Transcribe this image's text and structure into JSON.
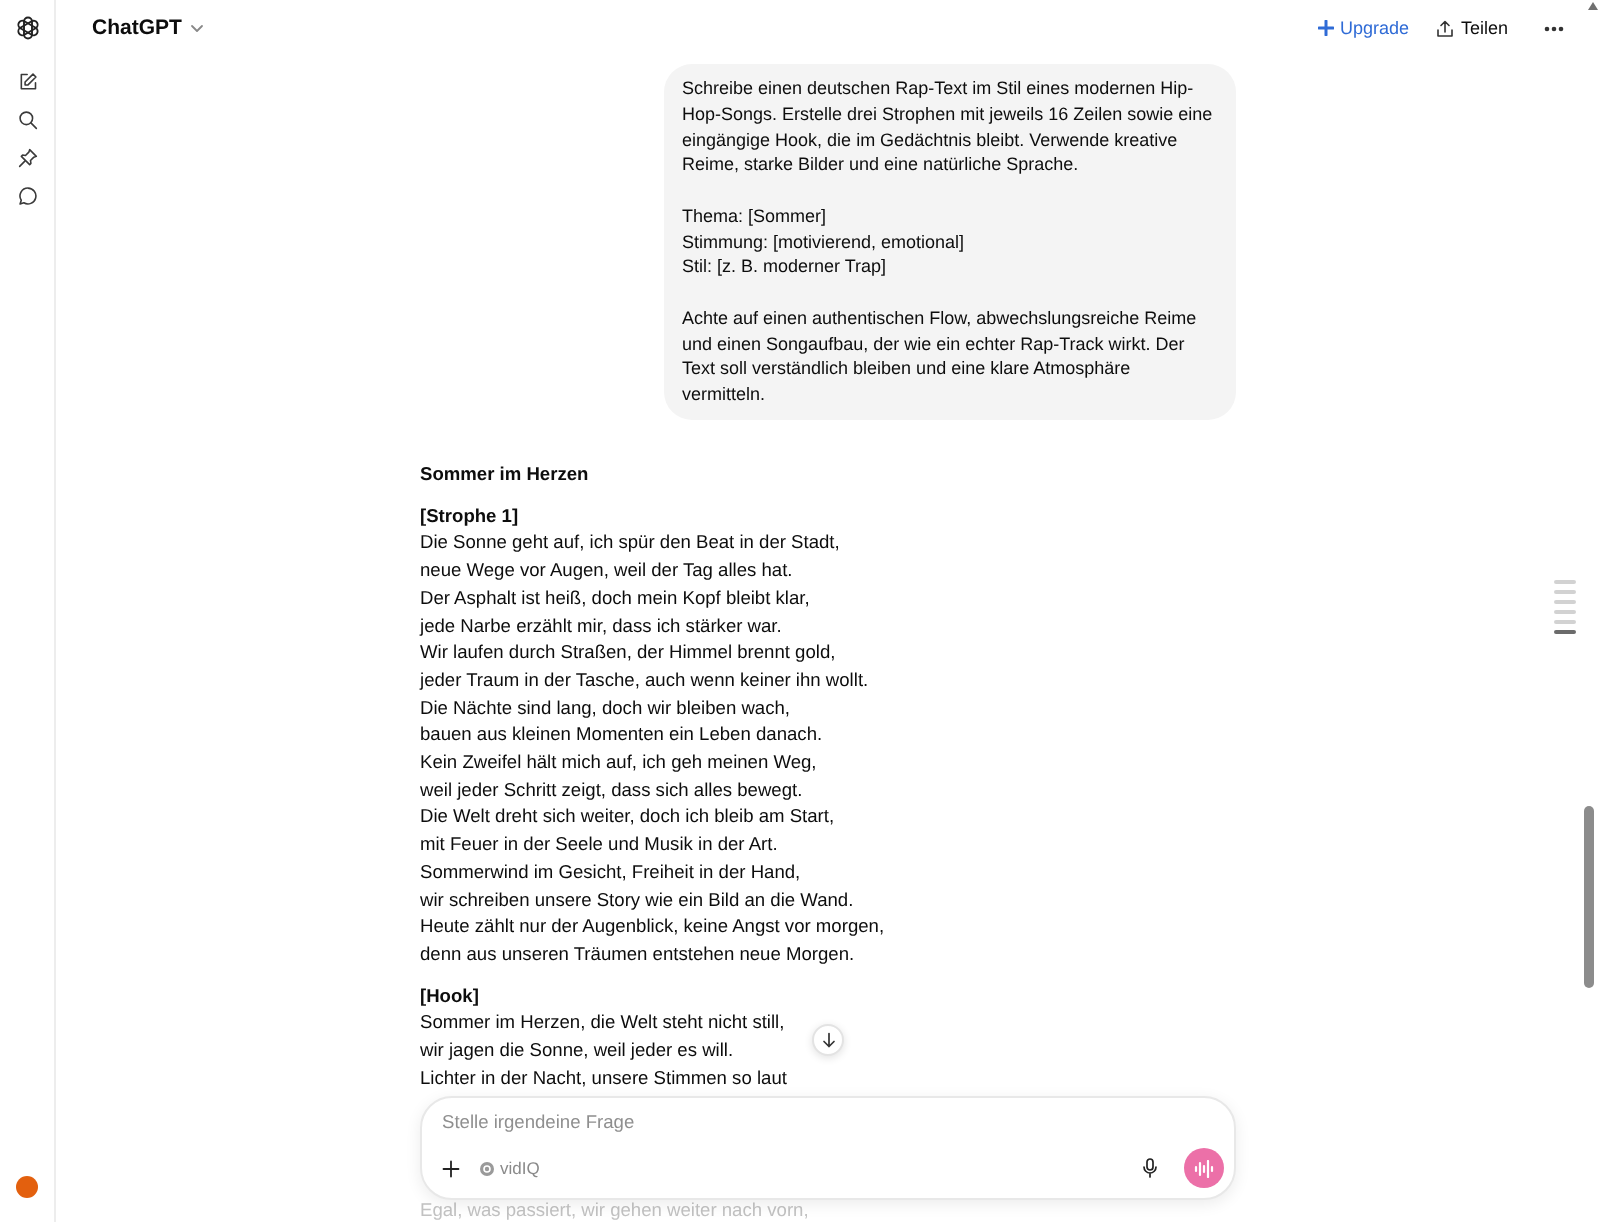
{
  "header": {
    "title": "ChatGPT",
    "upgrade": "Upgrade",
    "share": "Teilen"
  },
  "user_message": {
    "paragraphs": [
      [
        "Schreibe einen deutschen Rap-Text im Stil eines modernen Hip-Hop-Songs. Erstelle drei Strophen mit jeweils 16 Zeilen sowie eine eingängige Hook, die im Gedächtnis bleibt. Verwende kreative Reime, starke Bilder und eine natürliche Sprache."
      ],
      [
        "Thema: [Sommer]",
        "Stimmung: [motivierend, emotional]",
        "Stil: [z. B. moderner Trap]"
      ],
      [
        "Achte auf einen authentischen Flow, abwechslungsreiche Reime und einen Songaufbau, der wie ein echter Rap-Track wirkt. Der Text soll verständlich bleiben und eine klare Atmosphäre vermitteln."
      ]
    ]
  },
  "response": {
    "title": "Sommer im Herzen",
    "sections": [
      {
        "heading": "[Strophe 1]",
        "lines": [
          "Die Sonne geht auf, ich spür den Beat in der Stadt,",
          "neue Wege vor Augen, weil der Tag alles hat.",
          "Der Asphalt ist heiß, doch mein Kopf bleibt klar,",
          "jede Narbe erzählt mir, dass ich stärker war.",
          "Wir laufen durch Straßen, der Himmel brennt gold,",
          "jeder Traum in der Tasche, auch wenn keiner ihn wollt.",
          "Die Nächte sind lang, doch wir bleiben wach,",
          "bauen aus kleinen Momenten ein Leben danach.",
          "Kein Zweifel hält mich auf, ich geh meinen Weg,",
          "weil jeder Schritt zeigt, dass sich alles bewegt.",
          "Die Welt dreht sich weiter, doch ich bleib am Start,",
          "mit Feuer in der Seele und Musik in der Art.",
          "Sommerwind im Gesicht, Freiheit in der Hand,",
          "wir schreiben unsere Story wie ein Bild an die Wand.",
          "Heute zählt nur der Augenblick, keine Angst vor morgen,",
          "denn aus unseren Träumen entstehen neue Morgen."
        ]
      },
      {
        "heading": "[Hook]",
        "lines": [
          "Sommer im Herzen, die Welt steht nicht still,",
          "wir jagen die Sonne, weil jeder es will.",
          "Lichter in der Nacht, unsere Stimmen so laut"
        ],
        "faded_lines": [
          "Egal, was passiert, wir gehen weiter nach vorn,"
        ]
      }
    ]
  },
  "composer": {
    "placeholder": "Stelle irgendeine Frage",
    "extension": "vidIQ"
  },
  "scroll_markers": [
    {
      "selected": false
    },
    {
      "selected": false
    },
    {
      "selected": false
    },
    {
      "selected": false
    },
    {
      "selected": false
    },
    {
      "selected": true
    }
  ]
}
